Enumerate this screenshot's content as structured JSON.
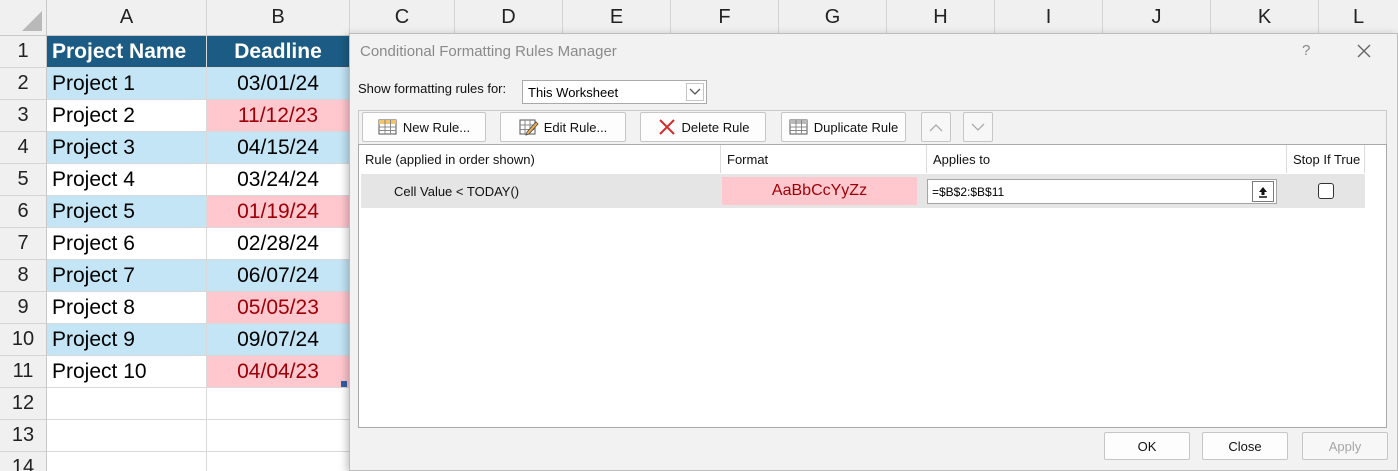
{
  "columns": [
    "A",
    "B",
    "C",
    "D",
    "E",
    "F",
    "G",
    "H",
    "I",
    "J",
    "K",
    "L"
  ],
  "rows": [
    "1",
    "2",
    "3",
    "4",
    "5",
    "6",
    "7",
    "8",
    "9",
    "10",
    "11",
    "12",
    "13",
    "14"
  ],
  "table": {
    "header": {
      "a": "Project Name",
      "b": "Deadline"
    },
    "rows": [
      {
        "a": "Project 1",
        "b": "03/01/24",
        "overdue": false
      },
      {
        "a": "Project 2",
        "b": "11/12/23",
        "overdue": true
      },
      {
        "a": "Project 3",
        "b": "04/15/24",
        "overdue": false
      },
      {
        "a": "Project 4",
        "b": "03/24/24",
        "overdue": false
      },
      {
        "a": "Project 5",
        "b": "01/19/24",
        "overdue": true
      },
      {
        "a": "Project 6",
        "b": "02/28/24",
        "overdue": false
      },
      {
        "a": "Project 7",
        "b": "06/07/24",
        "overdue": false
      },
      {
        "a": "Project 8",
        "b": "05/05/23",
        "overdue": true
      },
      {
        "a": "Project 9",
        "b": "09/07/24",
        "overdue": false
      },
      {
        "a": "Project 10",
        "b": "04/04/23",
        "overdue": true
      }
    ]
  },
  "dialog": {
    "title": "Conditional Formatting Rules Manager",
    "help": "?",
    "show_label": "Show formatting rules for:",
    "show_value": "This Worksheet",
    "buttons": {
      "new_rule": "New Rule...",
      "edit_rule": "Edit Rule...",
      "delete_rule": "Delete Rule",
      "duplicate_rule": "Duplicate Rule"
    },
    "columns": {
      "rule": "Rule (applied in order shown)",
      "format": "Format",
      "applies": "Applies to",
      "stop": "Stop If True"
    },
    "rule": {
      "text": "Cell Value < TODAY()",
      "format_preview": "AaBbCcYyZz",
      "applies_to": "=$B$2:$B$11",
      "stop_if_true": false
    },
    "footer": {
      "ok": "OK",
      "close": "Close",
      "apply": "Apply"
    }
  },
  "colors": {
    "header_fill": "#1c5c84",
    "band_fill": "#c4e5f5",
    "overdue_fill": "#ffc7ce",
    "overdue_text": "#9c0006"
  }
}
